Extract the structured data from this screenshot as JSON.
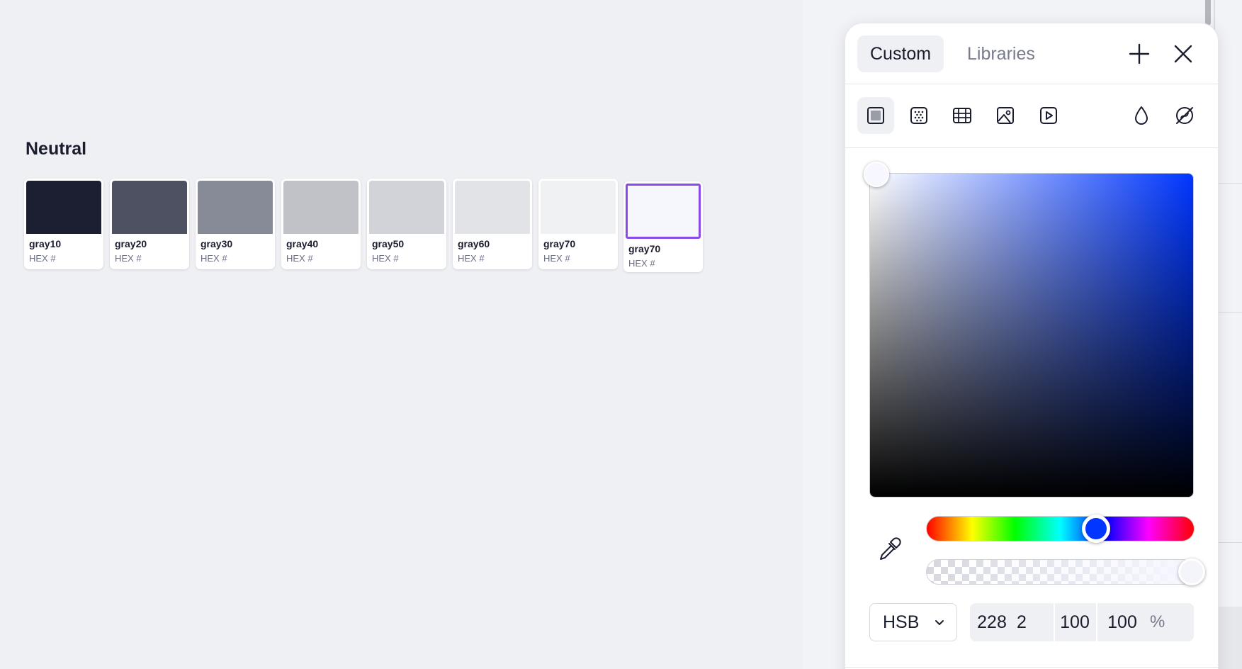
{
  "section": {
    "title": "Neutral"
  },
  "swatches": [
    {
      "name": "gray10",
      "hex_label": "HEX #",
      "color": "#1b1f31"
    },
    {
      "name": "gray20",
      "hex_label": "HEX #",
      "color": "#4d5162"
    },
    {
      "name": "gray30",
      "hex_label": "HEX #",
      "color": "#878b98"
    },
    {
      "name": "gray40",
      "hex_label": "HEX #",
      "color": "#c0c2c8"
    },
    {
      "name": "gray50",
      "hex_label": "HEX #",
      "color": "#d2d3d8"
    },
    {
      "name": "gray60",
      "hex_label": "HEX #",
      "color": "#e2e3e6"
    },
    {
      "name": "gray70",
      "hex_label": "HEX #",
      "color": "#f0f1f3"
    },
    {
      "name": "gray70",
      "hex_label": "HEX #",
      "color": "#f6f7fc",
      "selected": true
    }
  ],
  "picker": {
    "tabs": [
      {
        "label": "Custom",
        "active": true
      },
      {
        "label": "Libraries",
        "active": false
      }
    ],
    "fill_types": [
      "solid-fill-icon",
      "pattern-fill-icon",
      "grid-fill-icon",
      "image-fill-icon",
      "video-fill-icon"
    ],
    "mode": "HSB",
    "values": {
      "h": "228",
      "s": "2",
      "b": "100",
      "a": "100",
      "unit": "%"
    },
    "hue_degrees": 228,
    "alpha_percent": 100,
    "colors": {
      "accent_selected": "#8b4ae8",
      "pure_hue": "#0036ff",
      "current": "#f6f7ff"
    }
  }
}
